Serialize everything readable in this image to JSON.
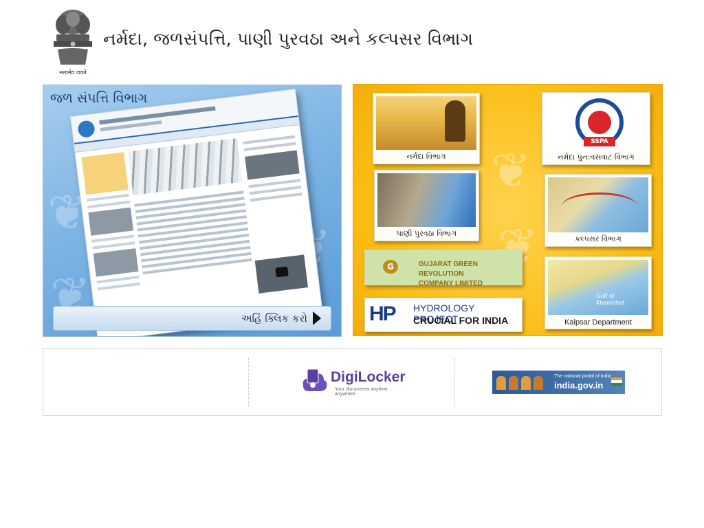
{
  "header": {
    "emblem_icon": "state-emblem-icon",
    "motto": "सत्यमेव जयते",
    "title": "નર્મદા, જળસંપત્તિ, પાણી પુરવઠા અને કલ્પસર વિભાગ"
  },
  "water_banner": {
    "title": "જળ સંપત્તિ વિભાગ",
    "link_text": "અહિં ક્લિક કરો",
    "arrow_icon": "arrow-right-icon"
  },
  "departments": {
    "narmada": "નર્મદા વિભાગ",
    "sspa": {
      "caption": "નર્મદા પુન:વસવાટ વિભાગ",
      "badge": "SSPA"
    },
    "water_supply": "પાણી પુરવઠા વિભાગ",
    "kalpsar": "કલ્પસર વિભાગ",
    "ggrc": {
      "badge": "G",
      "line1": "GUJARAT GREEN REVOLUTION",
      "line2": "COMPANY LIMITED"
    },
    "hydrology": {
      "mark": "HP",
      "line1": "HYDROLOGY PROJECT",
      "line2": "CRUCIAL FOR INDIA"
    },
    "kalpsar_map": {
      "caption": "Kalpsar Department",
      "gulf_line1": "Gulf of",
      "gulf_line2": "Khambhat"
    }
  },
  "links": {
    "digilocker": {
      "name": "DigiLocker",
      "tagline": "Your documents anytime, anywhere",
      "icon": "digilocker-icon"
    },
    "india_portal": {
      "line1": "The national portal of India",
      "line2": "india.gov.in",
      "flag_icon": "india-flag-icon"
    }
  },
  "colors": {
    "yellow_banner": "#fbbd14",
    "blue_banner": "#7db4e4",
    "digilocker_purple": "#5b3ea1",
    "india_portal_blue": "#2d5a97"
  }
}
